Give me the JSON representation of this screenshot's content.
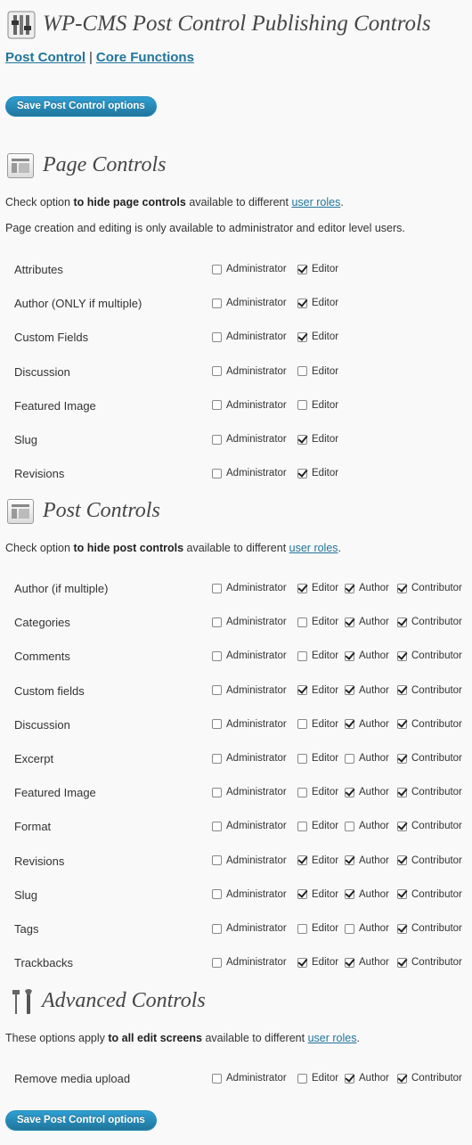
{
  "header": {
    "title": "WP-CMS Post Control Publishing Controls",
    "nav": {
      "post_control": "Post Control",
      "separator": "|",
      "core_functions": "Core Functions"
    },
    "save_label": "Save Post Control options"
  },
  "page_controls": {
    "title": "Page Controls",
    "desc": {
      "pre": "Check option ",
      "bold": "to hide page controls",
      "mid": " available to different ",
      "link": "user roles",
      "post": "."
    },
    "note": "Page creation and editing is only available to administrator and editor level users.",
    "roles": [
      "Administrator",
      "Editor"
    ],
    "rows": [
      {
        "label": "Attributes",
        "checked": [
          false,
          true
        ]
      },
      {
        "label": "Author (ONLY if multiple)",
        "checked": [
          false,
          true
        ]
      },
      {
        "label": "Custom Fields",
        "checked": [
          false,
          true
        ]
      },
      {
        "label": "Discussion",
        "checked": [
          false,
          false
        ]
      },
      {
        "label": "Featured Image",
        "checked": [
          false,
          false
        ]
      },
      {
        "label": "Slug",
        "checked": [
          false,
          true
        ]
      },
      {
        "label": "Revisions",
        "checked": [
          false,
          true
        ]
      }
    ]
  },
  "post_controls": {
    "title": "Post Controls",
    "desc": {
      "pre": "Check option ",
      "bold": "to hide post controls",
      "mid": " available to different ",
      "link": "user roles",
      "post": "."
    },
    "roles": [
      "Administrator",
      "Editor",
      "Author",
      "Contributor"
    ],
    "rows": [
      {
        "label": "Author (if multiple)",
        "checked": [
          false,
          true,
          true,
          true
        ]
      },
      {
        "label": "Categories",
        "checked": [
          false,
          false,
          true,
          true
        ]
      },
      {
        "label": "Comments",
        "checked": [
          false,
          false,
          true,
          true
        ]
      },
      {
        "label": "Custom fields",
        "checked": [
          false,
          true,
          true,
          true
        ]
      },
      {
        "label": "Discussion",
        "checked": [
          false,
          false,
          true,
          true
        ]
      },
      {
        "label": "Excerpt",
        "checked": [
          false,
          false,
          false,
          true
        ]
      },
      {
        "label": "Featured Image",
        "checked": [
          false,
          false,
          true,
          true
        ]
      },
      {
        "label": "Format",
        "checked": [
          false,
          false,
          false,
          true
        ]
      },
      {
        "label": "Revisions",
        "checked": [
          false,
          true,
          true,
          true
        ]
      },
      {
        "label": "Slug",
        "checked": [
          false,
          true,
          true,
          true
        ]
      },
      {
        "label": "Tags",
        "checked": [
          false,
          false,
          false,
          true
        ]
      },
      {
        "label": "Trackbacks",
        "checked": [
          false,
          true,
          true,
          true
        ]
      }
    ]
  },
  "advanced_controls": {
    "title": "Advanced Controls",
    "desc": {
      "pre": "These options apply ",
      "bold": "to all edit screens",
      "mid": " available to different ",
      "link": "user roles",
      "post": "."
    },
    "roles": [
      "Administrator",
      "Editor",
      "Author",
      "Contributor"
    ],
    "rows": [
      {
        "label": "Remove media upload",
        "checked": [
          false,
          false,
          true,
          true
        ]
      }
    ]
  },
  "icons": {
    "header": "tools-icon",
    "page_section": "layout-icon",
    "post_section": "layout-icon",
    "advanced_section": "tools-icon"
  }
}
